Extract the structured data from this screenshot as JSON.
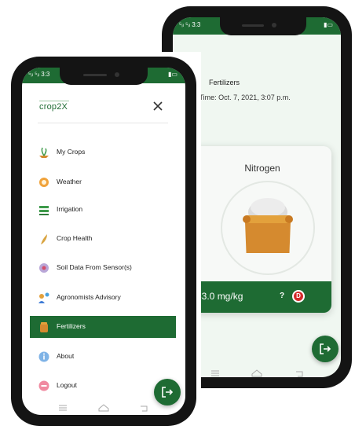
{
  "back_screen": {
    "status_signal": "⁵ᵢₗ ⁵ᵢₗ 3:3",
    "page_title": "Fertilizers",
    "date_text": "e/Time: Oct. 7, 2021, 3:07 p.m.",
    "card": {
      "title": "Nitrogen",
      "value": "33.0 mg/kg",
      "help": "?",
      "badge": "D"
    },
    "icons": {
      "fab": "logout-icon",
      "nav": [
        "recent-apps-icon",
        "home-icon",
        "back-icon"
      ]
    }
  },
  "front_screen": {
    "status_signal": "⁵ᵢₗ ⁵ᵢₗ 3:3",
    "logo": "crop2X",
    "close_label": "×",
    "menu": [
      {
        "label": "My Crops",
        "icon": "my-crops-icon"
      },
      {
        "label": "Weather",
        "icon": "weather-icon"
      },
      {
        "label": "Irrigation",
        "icon": "irrigation-icon"
      },
      {
        "label": "Crop Health",
        "icon": "crop-health-icon"
      },
      {
        "label": "Soil Data From Sensor(s)",
        "icon": "soil-sensor-icon"
      },
      {
        "label": "Agronomists Advisory",
        "icon": "agronomists-icon"
      },
      {
        "label": "Fertilizers",
        "icon": "fertilizers-icon",
        "active": true
      },
      {
        "label": "About",
        "icon": "about-icon"
      },
      {
        "label": "Logout",
        "icon": "logout-menu-icon"
      }
    ]
  },
  "colors": {
    "primary": "#1e6b33",
    "badge": "#d32a2a",
    "bag": "#d58a2f",
    "background": "#f0f7f1"
  }
}
